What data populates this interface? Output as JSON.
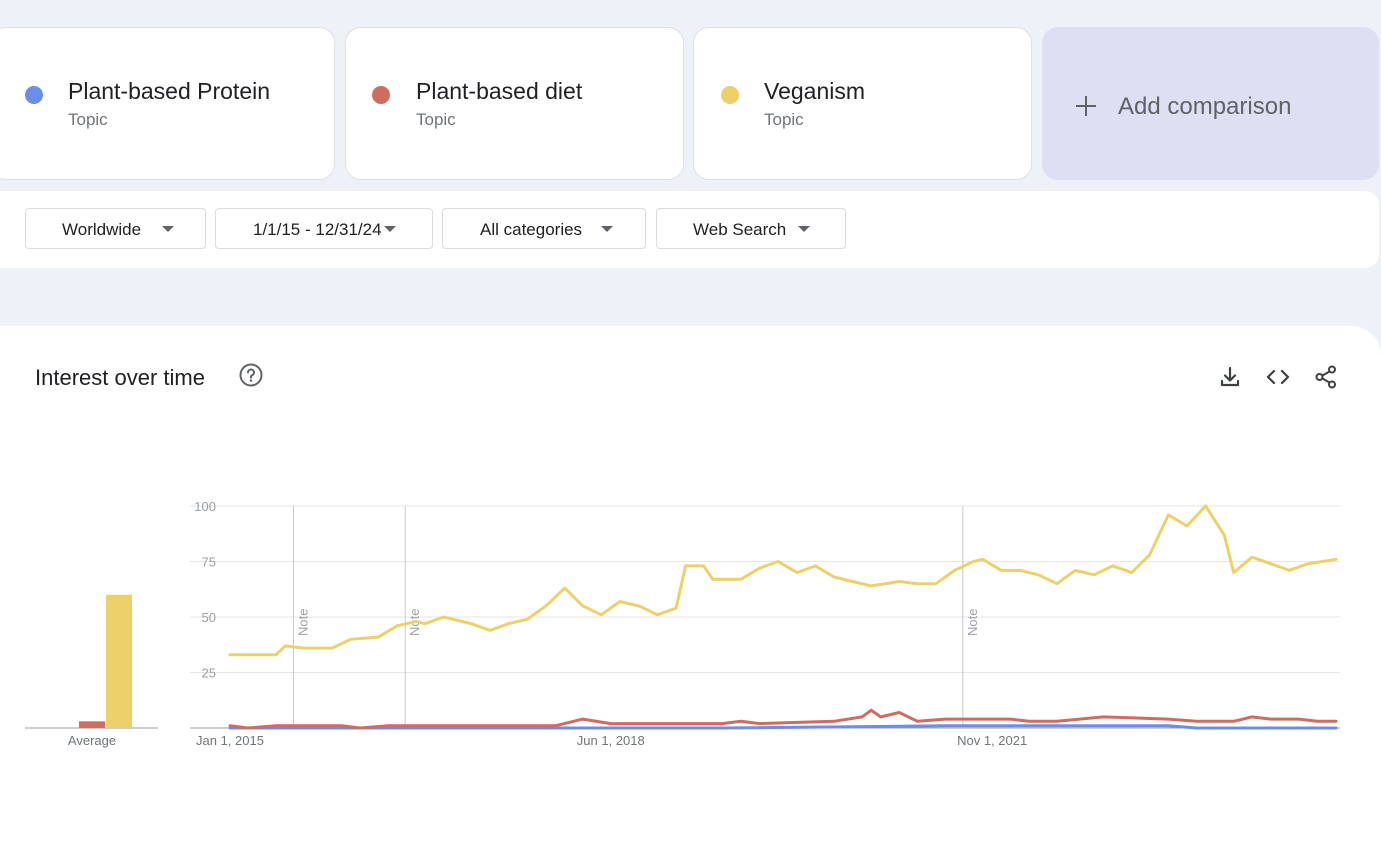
{
  "terms": [
    {
      "name": "Plant-based Protein",
      "type": "Topic",
      "color": "#6b8fe8"
    },
    {
      "name": "Plant-based diet",
      "type": "Topic",
      "color": "#cf6b5f"
    },
    {
      "name": "Veganism",
      "type": "Topic",
      "color": "#ecd06a"
    }
  ],
  "add_comparison": {
    "label": "Add comparison"
  },
  "filters": {
    "region": "Worldwide",
    "date_range": "1/1/15 - 12/31/24",
    "category": "All categories",
    "search_type": "Web Search"
  },
  "chart_section": {
    "title": "Interest over time"
  },
  "icons": [
    "help-icon",
    "download-icon",
    "embed-code-icon",
    "share-icon"
  ],
  "chart_data": {
    "type": "line",
    "x_range": [
      "2015-01-01",
      "2024-12-01"
    ],
    "ylim": [
      0,
      100
    ],
    "yticks": [
      25,
      50,
      75,
      100
    ],
    "xtick_labels": [
      {
        "date": "2015-01-01",
        "label": "Jan 1, 2015"
      },
      {
        "date": "2018-06-01",
        "label": "Jun 1, 2018"
      },
      {
        "date": "2021-11-01",
        "label": "Nov 1, 2021"
      }
    ],
    "notes": [
      {
        "date": "2016-01-01",
        "label": "Note"
      },
      {
        "date": "2017-01-01",
        "label": "Note"
      },
      {
        "date": "2022-01-01",
        "label": "Note"
      }
    ],
    "average": {
      "label": "Average",
      "values": [
        {
          "series": 0,
          "value": 0
        },
        {
          "series": 1,
          "value": 3
        },
        {
          "series": 2,
          "value": 60
        }
      ]
    },
    "series": [
      {
        "name": "Plant-based Protein",
        "color": "#6b8fe8",
        "points": [
          [
            "2015-01-01",
            0
          ],
          [
            "2019-06-01",
            0
          ],
          [
            "2021-06-01",
            1
          ],
          [
            "2023-06-01",
            1
          ],
          [
            "2023-09-01",
            0
          ],
          [
            "2024-12-01",
            0
          ]
        ]
      },
      {
        "name": "Plant-based diet",
        "color": "#cf6b5f",
        "points": [
          [
            "2015-01-01",
            1
          ],
          [
            "2015-03-01",
            0
          ],
          [
            "2015-06-01",
            1
          ],
          [
            "2016-01-01",
            1
          ],
          [
            "2016-03-01",
            0
          ],
          [
            "2016-06-01",
            1
          ],
          [
            "2017-12-01",
            1
          ],
          [
            "2018-03-01",
            4
          ],
          [
            "2018-06-01",
            2
          ],
          [
            "2019-06-01",
            2
          ],
          [
            "2019-08-01",
            3
          ],
          [
            "2019-10-01",
            2
          ],
          [
            "2020-06-01",
            3
          ],
          [
            "2020-09-01",
            5
          ],
          [
            "2020-10-01",
            8
          ],
          [
            "2020-11-01",
            5
          ],
          [
            "2021-01-01",
            7
          ],
          [
            "2021-03-01",
            3
          ],
          [
            "2021-06-01",
            4
          ],
          [
            "2022-01-01",
            4
          ],
          [
            "2022-03-01",
            3
          ],
          [
            "2022-06-01",
            3
          ],
          [
            "2022-11-01",
            5
          ],
          [
            "2023-06-01",
            4
          ],
          [
            "2023-09-01",
            3
          ],
          [
            "2024-01-01",
            3
          ],
          [
            "2024-03-01",
            5
          ],
          [
            "2024-05-01",
            4
          ],
          [
            "2024-08-01",
            4
          ],
          [
            "2024-10-01",
            3
          ],
          [
            "2024-12-01",
            3
          ]
        ]
      },
      {
        "name": "Veganism",
        "color": "#ecd06a",
        "points": [
          [
            "2015-01-01",
            33
          ],
          [
            "2015-06-01",
            33
          ],
          [
            "2015-07-01",
            37
          ],
          [
            "2015-09-01",
            36
          ],
          [
            "2015-12-01",
            36
          ],
          [
            "2016-02-01",
            40
          ],
          [
            "2016-05-01",
            41
          ],
          [
            "2016-07-01",
            46
          ],
          [
            "2016-09-01",
            48
          ],
          [
            "2016-10-01",
            47
          ],
          [
            "2016-12-01",
            50
          ],
          [
            "2017-03-01",
            47
          ],
          [
            "2017-05-01",
            44
          ],
          [
            "2017-07-01",
            47
          ],
          [
            "2017-09-01",
            49
          ],
          [
            "2017-11-01",
            55
          ],
          [
            "2018-01-01",
            63
          ],
          [
            "2018-03-01",
            55
          ],
          [
            "2018-05-01",
            51
          ],
          [
            "2018-07-01",
            57
          ],
          [
            "2018-09-01",
            55
          ],
          [
            "2018-11-01",
            51
          ],
          [
            "2019-01-01",
            54
          ],
          [
            "2019-02-01",
            73
          ],
          [
            "2019-04-01",
            73
          ],
          [
            "2019-05-01",
            67
          ],
          [
            "2019-08-01",
            67
          ],
          [
            "2019-10-01",
            72
          ],
          [
            "2019-12-01",
            75
          ],
          [
            "2020-02-01",
            70
          ],
          [
            "2020-04-01",
            73
          ],
          [
            "2020-06-01",
            68
          ],
          [
            "2020-08-01",
            66
          ],
          [
            "2020-10-01",
            64
          ],
          [
            "2021-01-01",
            66
          ],
          [
            "2021-03-01",
            65
          ],
          [
            "2021-05-01",
            65
          ],
          [
            "2021-07-01",
            71
          ],
          [
            "2021-09-01",
            75
          ],
          [
            "2021-10-01",
            76
          ],
          [
            "2021-12-01",
            71
          ],
          [
            "2022-02-01",
            71
          ],
          [
            "2022-04-01",
            69
          ],
          [
            "2022-06-01",
            65
          ],
          [
            "2022-08-01",
            71
          ],
          [
            "2022-10-01",
            69
          ],
          [
            "2022-12-01",
            73
          ],
          [
            "2023-02-01",
            70
          ],
          [
            "2023-04-01",
            78
          ],
          [
            "2023-06-01",
            96
          ],
          [
            "2023-08-01",
            91
          ],
          [
            "2023-10-01",
            100
          ],
          [
            "2023-12-01",
            87
          ],
          [
            "2024-01-01",
            70
          ],
          [
            "2024-03-01",
            77
          ],
          [
            "2024-05-01",
            74
          ],
          [
            "2024-07-01",
            71
          ],
          [
            "2024-09-01",
            74
          ],
          [
            "2024-12-01",
            76
          ]
        ]
      }
    ]
  }
}
